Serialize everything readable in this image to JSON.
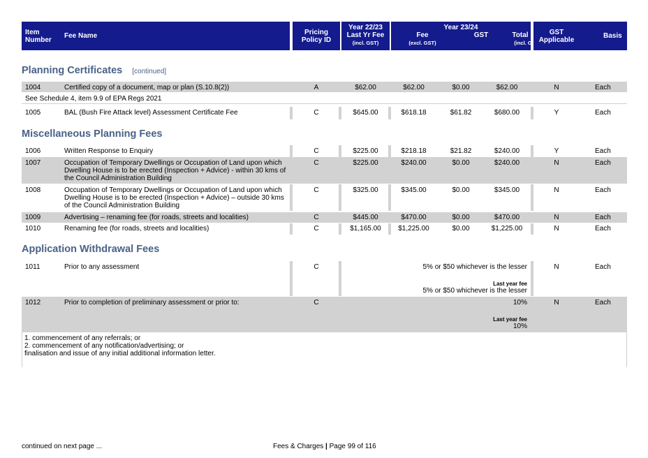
{
  "header": {
    "item_number": [
      "Item",
      "Number"
    ],
    "fee_name": "Fee Name",
    "pricing_policy": [
      "Pricing",
      "Policy ID"
    ],
    "year_prev": "Year 22/23",
    "last_yr_fee": "Last Yr Fee",
    "incl_gst_1": "(incl. GST)",
    "year_curr": "Year 23/24",
    "fee": "Fee",
    "excl_gst": "(excl. GST)",
    "gst": "GST",
    "total_fee": "Total Fee",
    "incl_gst_2": "(incl. GST)",
    "gst_applicable": [
      "GST",
      "Applicable"
    ],
    "basis": "Basis"
  },
  "sections": {
    "planning_certificates": {
      "title": "Planning Certificates",
      "continued": "[continued]"
    },
    "misc_planning": {
      "title": "Miscellaneous Planning Fees"
    },
    "withdrawal": {
      "title": "Application Withdrawal Fees"
    }
  },
  "rows": [
    {
      "item": "1004",
      "name": "Certified copy of a document, map or plan (S.10.8(2))",
      "policy": "A",
      "last": "$62.00",
      "fee": "$62.00",
      "gst": "$0.00",
      "total": "$62.00",
      "applicable": "N",
      "basis": "Each"
    },
    {
      "item": "1005",
      "name": "BAL (Bush Fire Attack level) Assessment Certificate Fee",
      "policy": "C",
      "last": "$645.00",
      "fee": "$618.18",
      "gst": "$61.82",
      "total": "$680.00",
      "applicable": "Y",
      "basis": "Each"
    },
    {
      "item": "1006",
      "name": "Written Response to Enquiry",
      "policy": "C",
      "last": "$225.00",
      "fee": "$218.18",
      "gst": "$21.82",
      "total": "$240.00",
      "applicable": "Y",
      "basis": "Each"
    },
    {
      "item": "1007",
      "name_lines": [
        "Occupation of Temporary Dwellings or Occupation of Land upon which",
        "Dwelling House is to be erected (Inspection + Advice) - within 30 kms of",
        "the Council Administration Building"
      ],
      "policy": "C",
      "last": "$225.00",
      "fee": "$240.00",
      "gst": "$0.00",
      "total": "$240.00",
      "applicable": "N",
      "basis": "Each"
    },
    {
      "item": "1008",
      "name_lines": [
        "Occupation of Temporary Dwellings or Occupation of Land upon which",
        "Dwelling House is to be erected (Inspection + Advice) – outside 30 kms",
        "of the Council Administration Building"
      ],
      "policy": "C",
      "last": "$325.00",
      "fee": "$345.00",
      "gst": "$0.00",
      "total": "$345.00",
      "applicable": "N",
      "basis": "Each"
    },
    {
      "item": "1009",
      "name": "Advertising – renaming fee (for roads, streets and localities)",
      "policy": "C",
      "last": "$445.00",
      "fee": "$470.00",
      "gst": "$0.00",
      "total": "$470.00",
      "applicable": "N",
      "basis": "Each"
    },
    {
      "item": "1010",
      "name": "Renaming fee (for roads, streets and localities)",
      "policy": "C",
      "last": "$1,165.00",
      "fee": "$1,225.00",
      "gst": "$0.00",
      "total": "$1,225.00",
      "applicable": "N",
      "basis": "Each"
    },
    {
      "item": "1011",
      "name": "Prior to any assessment",
      "policy": "C",
      "fee_text": "5% or $50 whichever is the lesser",
      "last_label": "Last year fee",
      "last_text": "5% or $50 whichever is the lesser",
      "applicable": "N",
      "basis": "Each"
    },
    {
      "item": "1012",
      "name": "Prior to completion of preliminary assessment or prior to:",
      "policy": "C",
      "fee_text": "10%",
      "last_label": "Last year fee",
      "last_text": "10%",
      "applicable": "N",
      "basis": "Each"
    }
  ],
  "notes": {
    "row_1004": "See Schedule 4, item 9.9 of EPA Regs 2021",
    "row_1012": [
      "1. commencement of any referrals; or",
      "2. commencement of any notification/advertising; or",
      "finalisation and issue of any initial additional information letter."
    ]
  },
  "footer": {
    "continued": "continued on next page ...",
    "page_prefix": "Fees & Charges",
    "separator": "|",
    "page_text": "Page 99 of 116"
  }
}
